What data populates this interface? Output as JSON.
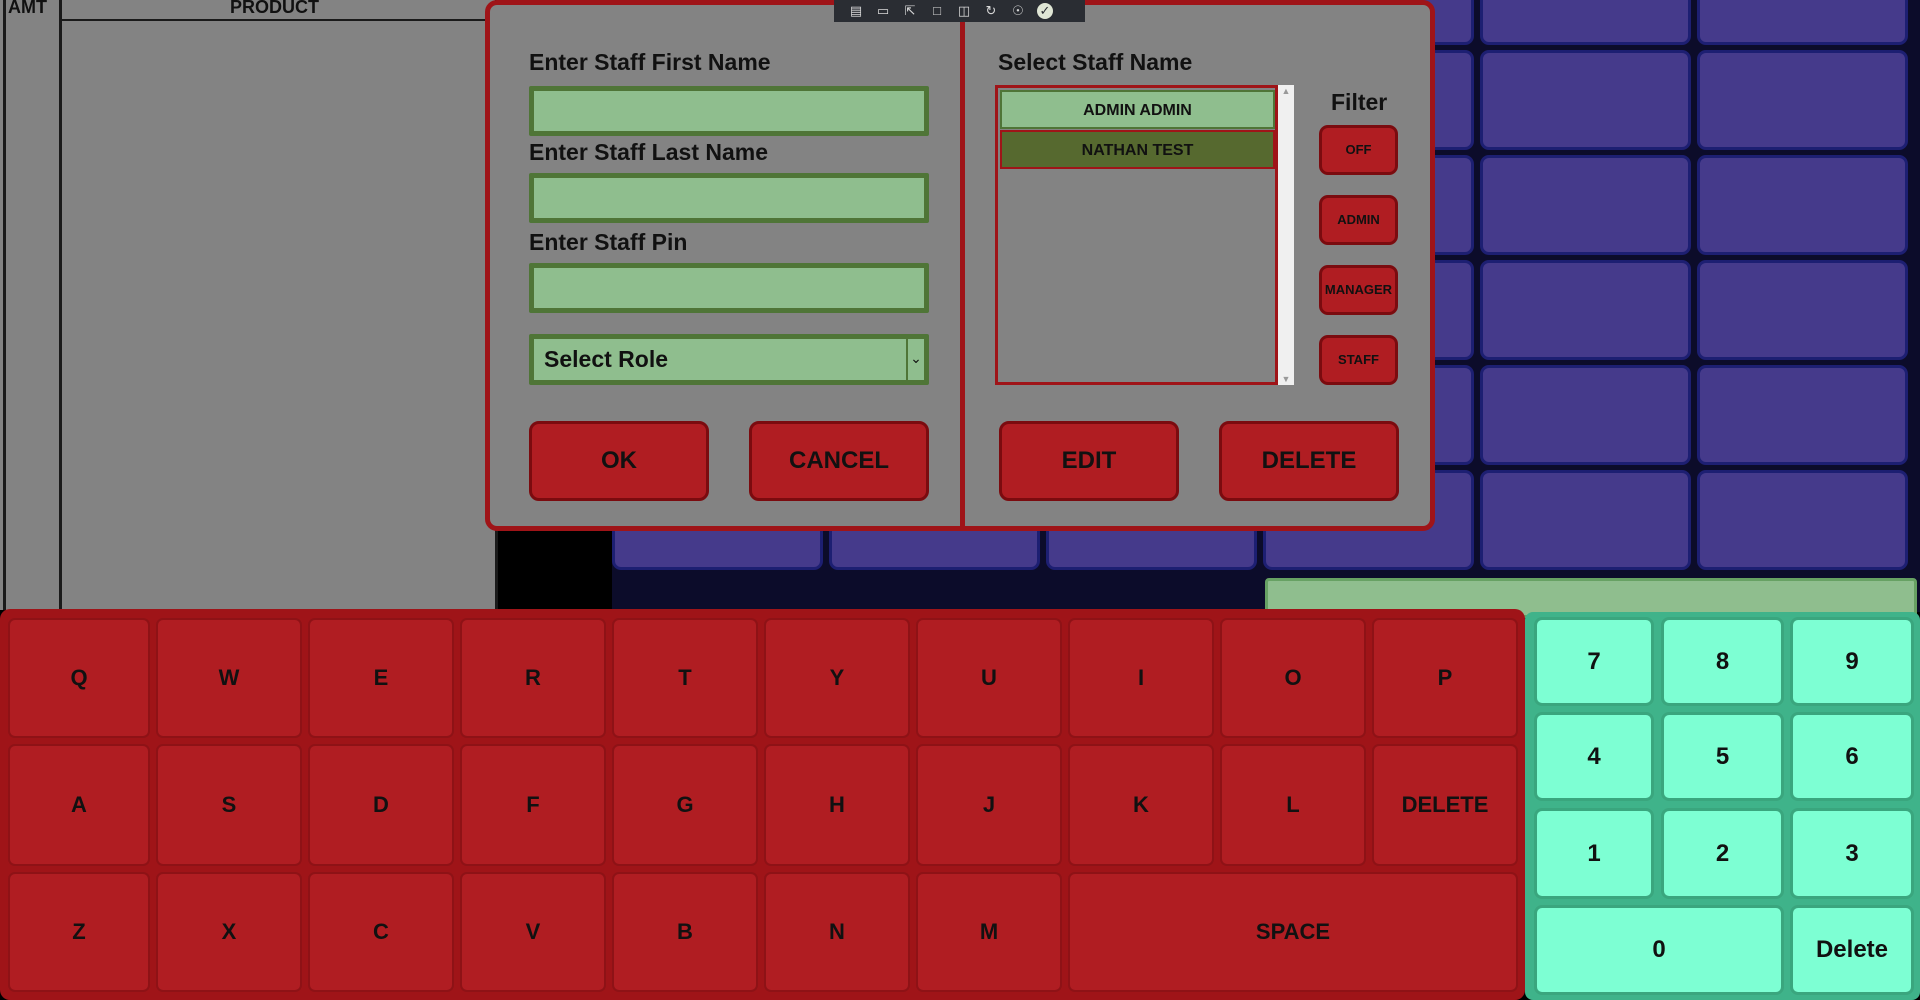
{
  "order": {
    "col_amt": "AMT",
    "col_product": "PRODUCT"
  },
  "dialog": {
    "first_name_label": "Enter Staff First Name",
    "last_name_label": "Enter Staff Last Name",
    "pin_label": "Enter Staff Pin",
    "first_name_value": "",
    "last_name_value": "",
    "pin_value": "",
    "role_select": "Select Role",
    "ok_label": "OK",
    "cancel_label": "CANCEL",
    "select_staff_label": "Select Staff Name",
    "staff_list": [
      "ADMIN ADMIN",
      "NATHAN TEST"
    ],
    "filter_label": "Filter",
    "filters": [
      "OFF",
      "ADMIN",
      "MANAGER",
      "STAFF"
    ],
    "edit_label": "EDIT",
    "delete_label": "DELETE"
  },
  "toolbar_icons": [
    "tray-icon",
    "video-icon",
    "select-icon",
    "frame-icon",
    "display-icon",
    "sync-icon",
    "accessibility-icon",
    "check-icon"
  ],
  "keyboard": {
    "row1": [
      "Q",
      "W",
      "E",
      "R",
      "T",
      "Y",
      "U",
      "I",
      "O",
      "P"
    ],
    "row2": [
      "A",
      "S",
      "D",
      "F",
      "G",
      "H",
      "J",
      "K",
      "L",
      "DELETE"
    ],
    "row3": [
      "Z",
      "X",
      "C",
      "V",
      "B",
      "N",
      "M"
    ],
    "space": "SPACE"
  },
  "numpad": {
    "keys": [
      "7",
      "8",
      "9",
      "4",
      "5",
      "6",
      "1",
      "2",
      "3"
    ],
    "zero": "0",
    "delete": "Delete"
  },
  "colors": {
    "accent_red": "#b01d22",
    "dialog_border": "#9f1418",
    "field_green": "#8fbe8e",
    "selected_staff": "#56692f",
    "grid_cell": "#453a8b",
    "numpad_key": "#7dffd3"
  }
}
